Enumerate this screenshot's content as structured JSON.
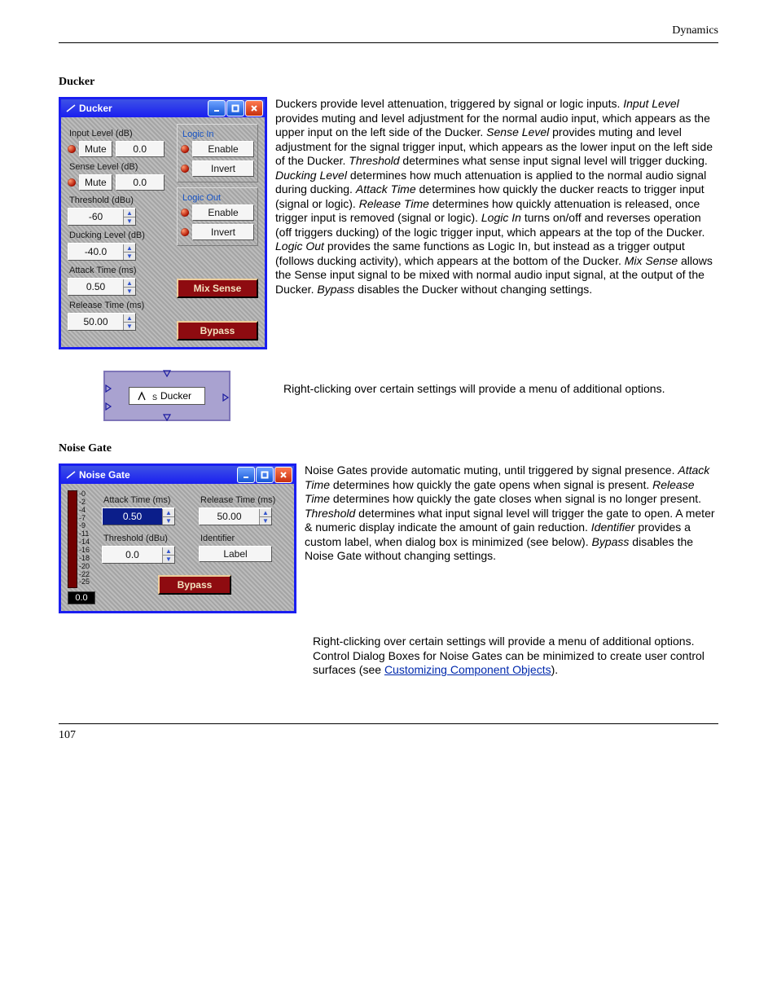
{
  "header_text": "Dynamics",
  "footer_text": "107",
  "ducker": {
    "title": "Ducker",
    "section_title": "Ducker",
    "input_level_label": "Input Level (dB)",
    "input_level_value": "0.0",
    "mute_label": "Mute",
    "sense_level_label": "Sense Level (dB)",
    "sense_level_value": "0.0",
    "threshold_label": "Threshold (dBu)",
    "threshold_value": "-60",
    "ducking_level_label": "Ducking Level (dB)",
    "ducking_level_value": "-40.0",
    "attack_time_label": "Attack Time (ms)",
    "attack_time_value": "0.50",
    "release_time_label": "Release Time (ms)",
    "release_time_value": "50.00",
    "logic_in_label": "Logic In",
    "logic_out_label": "Logic Out",
    "enable_label": "Enable",
    "invert_label": "Invert",
    "mix_sense_label": "Mix Sense",
    "bypass_label": "Bypass",
    "desc": {
      "p1a": "Duckers provide level attenuation, triggered by signal or logic inputs. ",
      "t_input_level": "Input Level",
      "p1b": " provides muting and level adjustment for the normal audio input, which appears as the upper input on the left side of the Ducker. ",
      "t_sense_level": "Sense Level",
      "p1c": " provides muting and level adjustment for the signal trigger input, which appears as the lower input on the left side of the Ducker. ",
      "t_threshold": "Threshold",
      "p1d": " determines what sense input signal level will trigger ducking. ",
      "t_ducking_level": "Ducking Level",
      "p1e": " determines how much attenuation is applied to the normal audio signal during ducking. ",
      "t_attack": "Attack Time",
      "p1f": " determines how quickly the ducker reacts to trigger input (signal or logic). ",
      "t_release": "Release Time",
      "p1g": " determines how quickly attenuation is released, once trigger input is removed (signal or logic). ",
      "t_logic_in": "Logic In",
      "p1h": " turns on/off and reverses operation (off triggers ducking) of the logic trigger input, which appears at the top of the Ducker. ",
      "t_logic_out": "Logic Out",
      "p1i": " provides the same functions as Logic In, but instead as a trigger output (follows ducking activity), which appears at the bottom of the Ducker. ",
      "t_mix_sense": "Mix Sense",
      "p1j": " allows the Sense input signal to be mixed with normal audio input signal, at the output of the Ducker. ",
      "t_bypass": "Bypass",
      "p1k": " disables the Ducker without changing settings."
    },
    "block_label": "Ducker",
    "block_sub": "S",
    "right_click_note": "Right-clicking over certain settings will provide a menu of additional options."
  },
  "noise_gate": {
    "title": "Noise Gate",
    "section_title": "Noise Gate",
    "meter_ticks": [
      "-0",
      "-2",
      "-4",
      "-7",
      "-9",
      "-11",
      "-14",
      "-16",
      "-18",
      "-20",
      "-22",
      "-25"
    ],
    "meter_value": "0.0",
    "attack_time_label": "Attack Time (ms)",
    "attack_time_value": "0.50",
    "release_time_label": "Release Time (ms)",
    "release_time_value": "50.00",
    "threshold_label": "Threshold (dBu)",
    "threshold_value": "0.0",
    "identifier_label": "Identifier",
    "identifier_value": "Label",
    "bypass_label": "Bypass",
    "desc": {
      "p1a": "Noise Gates provide automatic muting, until triggered by signal presence. ",
      "t_attack": "Attack Time",
      "p1b": " determines how quickly the gate opens when signal is present. ",
      "t_release": "Release Time",
      "p1c": " determines how quickly the gate closes when signal is no longer present. ",
      "t_threshold": "Threshold",
      "p1d": " determines what input signal level will trigger the gate to open. A meter & numeric display indicate the amount of gain reduction. ",
      "t_identifier": "Identifier",
      "p1e": " provides a custom label, when dialog box is minimized (see below). ",
      "t_bypass": "Bypass",
      "p1f": " disables the Noise Gate without changing settings."
    },
    "right_click_a": "Right-clicking over certain settings will provide a menu of additional options. Control Dialog Boxes for Noise Gates can be minimized to create user control surfaces (see ",
    "right_click_link": "Customizing Component Objects",
    "right_click_b": ")."
  }
}
